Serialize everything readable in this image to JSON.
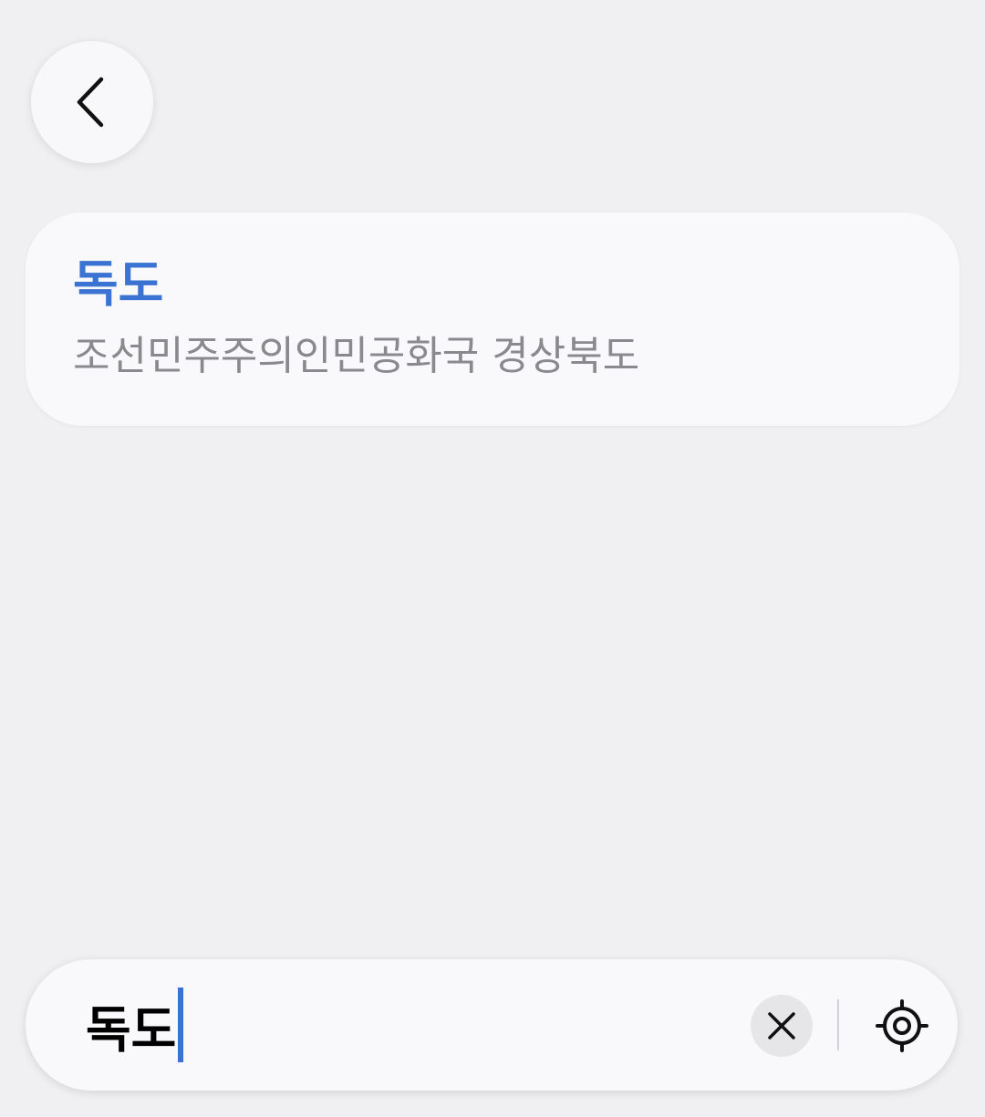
{
  "colors": {
    "background": "#f0f0f2",
    "card": "#f9f9fb",
    "accent": "#3a73d1",
    "subtitle": "#8a8a8e",
    "text": "#000000"
  },
  "header": {
    "back_icon": "chevron-left-icon"
  },
  "results": [
    {
      "title": "독도",
      "subtitle": "조선민주주의인민공화국 경상북도"
    }
  ],
  "search": {
    "value": "독도",
    "clear_icon": "close-icon",
    "locate_icon": "crosshair-location-icon"
  }
}
